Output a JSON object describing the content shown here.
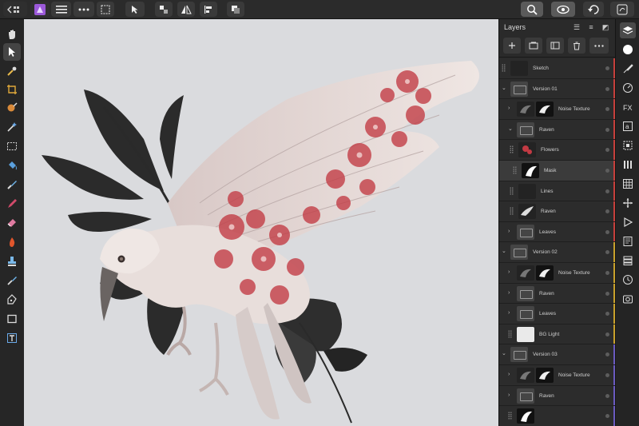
{
  "panel": {
    "title": "Layers"
  },
  "layers": [
    {
      "name": "Sketch",
      "kind": "dark2",
      "indent": 0,
      "chevron": "",
      "strip": "#c7403c"
    },
    {
      "name": "Version 01",
      "kind": "folder",
      "indent": 0,
      "chevron": "v",
      "strip": "#c7403c"
    },
    {
      "name": "Noise Texture",
      "kind": "noise",
      "indent": 1,
      "chevron": ">",
      "strip": "#c7403c"
    },
    {
      "name": "Raven",
      "kind": "folder",
      "indent": 1,
      "chevron": "v",
      "strip": "#c7403c"
    },
    {
      "name": "Flowers",
      "kind": "flower",
      "indent": 2,
      "chevron": "",
      "strip": "#c7403c"
    },
    {
      "name": "Mask",
      "kind": "mask",
      "indent": 3,
      "chevron": "",
      "strip": "#c7403c",
      "selected": true
    },
    {
      "name": "Lines",
      "kind": "dark2",
      "indent": 2,
      "chevron": "",
      "strip": "#c7403c"
    },
    {
      "name": "Raven",
      "kind": "raven",
      "indent": 2,
      "chevron": "",
      "strip": "#c7403c"
    },
    {
      "name": "Leaves",
      "kind": "folder",
      "indent": 1,
      "chevron": ">",
      "strip": "#c7403c"
    },
    {
      "name": "Version 02",
      "kind": "folder",
      "indent": 0,
      "chevron": "v",
      "strip": "#c9a12c"
    },
    {
      "name": "Noise Texture",
      "kind": "noise",
      "indent": 1,
      "chevron": ">",
      "strip": "#c9a12c"
    },
    {
      "name": "Raven",
      "kind": "folder",
      "indent": 1,
      "chevron": ">",
      "strip": "#c9a12c"
    },
    {
      "name": "Leaves",
      "kind": "folder",
      "indent": 1,
      "chevron": ">",
      "strip": "#c9a12c"
    },
    {
      "name": "BG Light",
      "kind": "light",
      "indent": 1,
      "chevron": "",
      "strip": "#c9a12c"
    },
    {
      "name": "Version 03",
      "kind": "folder",
      "indent": 0,
      "chevron": "v",
      "strip": "#6a5bbf"
    },
    {
      "name": "Noise Texture",
      "kind": "noise",
      "indent": 1,
      "chevron": ">",
      "strip": "#6a5bbf"
    },
    {
      "name": "Raven",
      "kind": "folder",
      "indent": 1,
      "chevron": ">",
      "strip": "#6a5bbf"
    },
    {
      "name": "",
      "kind": "mask",
      "indent": 1,
      "chevron": "",
      "strip": "#6a5bbf"
    }
  ],
  "colors": {
    "canvas_bg": "#dadbde",
    "accent_red": "#c7403c",
    "accent_yellow": "#c9a12c",
    "accent_purple": "#6a5bbf",
    "persona_icon": "#9b59d9"
  },
  "toolbar": {
    "icons": [
      "back-icon",
      "persona-icon",
      "menu-icon",
      "more-icon",
      "selection-icon",
      "move-icon",
      "snapping-icon",
      "flip-icon",
      "align-icon",
      "arrange-icon",
      "zoom-icon",
      "view-icon",
      "undo-icon",
      "help-icon"
    ]
  }
}
